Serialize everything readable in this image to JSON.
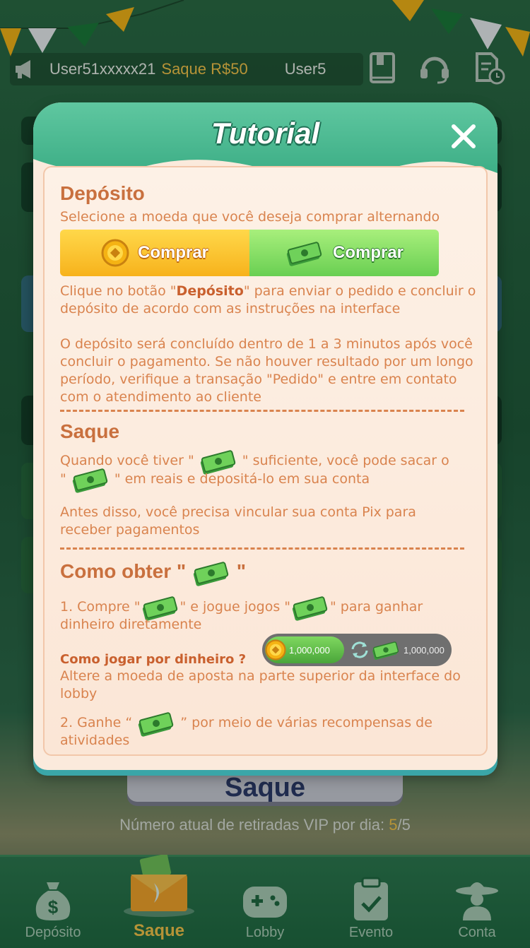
{
  "ticker": {
    "user": "User51xxxxx21",
    "amount": "Saque R$50",
    "user2": "User5"
  },
  "background": {
    "saque_button": "Saque",
    "vip_prefix": "Número atual de retiradas VIP por dia: ",
    "vip_current": "5",
    "vip_sep": "/",
    "vip_total": "5"
  },
  "nav": {
    "items": [
      {
        "label": "Depósito",
        "icon": "money-bag-icon"
      },
      {
        "label": "Saque",
        "icon": "withdraw-envelope-icon"
      },
      {
        "label": "Lobby",
        "icon": "gamepad-icon"
      },
      {
        "label": "Evento",
        "icon": "clipboard-check-icon"
      },
      {
        "label": "Conta",
        "icon": "sombrero-user-icon"
      }
    ]
  },
  "modal": {
    "title": "Tutorial",
    "deposit": {
      "heading": "Depósito",
      "intro": "Selecione a moeda que você deseja comprar alternando",
      "btn_gold": "Comprar",
      "btn_green": "Comprar",
      "p1_a": "Clique no botão \"",
      "p1_bold": "Depósito",
      "p1_b": "\" para enviar o pedido e concluir o depósito de acordo com as instruções na interface",
      "p2": "O depósito será concluído dentro de 1 a 3 minutos após você concluir o pagamento. Se não houver resultado por um longo período, verifique a transação \"Pedido\" e entre em contato com o atendimento ao cliente"
    },
    "saque": {
      "heading": "Saque",
      "p1_a": "Quando você tiver \"",
      "p1_b": "\" suficiente, você pode sacar o",
      "p1_c": "\"",
      "p1_d": "\" em reais e depositá-lo em sua conta",
      "p2": "Antes disso, você precisa vincular sua conta Pix para receber pagamentos"
    },
    "obter": {
      "heading_a": "Como obter \"",
      "heading_b": "\"",
      "l1_a": "1. Compre \"",
      "l1_b": "\" e jogue jogos \"",
      "l1_c": "\" para ganhar",
      "l1_d": "dinheiro diretamente",
      "how_title": "Como jogar por dinheiro ?",
      "pill_gold": "1,000,000",
      "pill_green": "1,000,000",
      "how_text": "Altere a moeda de aposta na parte superior da interface do lobby",
      "l2_a": "2. Ganhe “",
      "l2_b": "” por meio de várias recompensas de",
      "l2_c": "atividades"
    }
  },
  "colors": {
    "accent_text": "#d9834e",
    "heading": "#c9703e",
    "header_green": "#3dae86",
    "gold": "#f7b21c",
    "green_button": "#69cf52"
  }
}
